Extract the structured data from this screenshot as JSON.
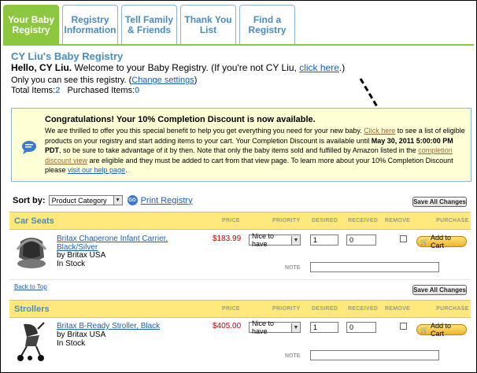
{
  "tabs": [
    {
      "label": "Your Baby\nRegistry",
      "active": true
    },
    {
      "label": "Registry\nInformation",
      "active": false
    },
    {
      "label": "Tell Family\n& Friends",
      "active": false
    },
    {
      "label": "Thank You\nList",
      "active": false
    },
    {
      "label": "Find a\nRegistry",
      "active": false
    }
  ],
  "header": {
    "title": "CY Liu's Baby Registry",
    "hello_bold": "Hello, CY Liu.",
    "hello_text": " Welcome to your Baby Registry. (If you're not CY Liu, ",
    "click_here": "click here",
    "hello_end": ".)",
    "only_text": "Only you can see this registry. (",
    "change_settings": "Change settings",
    "only_end": ")",
    "total_label": "Total Items:",
    "total_value": "2",
    "purchased_label": "Purchased Items:",
    "purchased_value": "0"
  },
  "banner": {
    "title": "Congratulations! Your 10% Completion Discount is now available.",
    "t1": "We are thrilled to offer you this special benefit to help you get everything you need for your new baby. ",
    "click_here": "Click here",
    "t2": " to see a list of eligible products on your registry and start adding items to your cart. Your Completion Discount is available until ",
    "date": "May 30, 2011 5:00:00 PM PDT",
    "t3": ", so be sure to take advantage of it by then. Note that only the baby items sold and fulfilled by Amazon listed in the ",
    "discount_view": "completion discount view",
    "t4": " are eligible and they must be added to cart from that view page. To learn more about your 10% Completion Discount please ",
    "help_page": "visit our help page",
    "t5": "."
  },
  "sort": {
    "label": "Sort by:",
    "selected": "Product Category",
    "go": "GO",
    "print": "Print Registry",
    "save_all": "Save All Changes"
  },
  "columns": {
    "price": "PRICE",
    "priority": "PRIORITY",
    "desired": "DESIRED",
    "received": "RECEIVED",
    "remove": "REMOVE",
    "purchase": "PURCHASE",
    "note": "NOTE"
  },
  "sections": [
    {
      "name": "Car Seats",
      "item": {
        "title_line1": "Britax Chaperone Infant Carrier,",
        "title_line2": "Black/Silver",
        "by": "by Britax USA",
        "stock": "In Stock",
        "price": "$183.99",
        "priority": "Nice to have",
        "desired": "1",
        "received": "0",
        "add_to_cart": "Add to Cart"
      }
    },
    {
      "name": "Strollers",
      "item": {
        "title_line1": "Britax B-Ready Stroller, Black",
        "title_line2": "",
        "by": "by Britax USA",
        "stock": "In Stock",
        "price": "$405.00",
        "priority": "Nice to have",
        "desired": "1",
        "received": "0",
        "add_to_cart": "Add to Cart"
      }
    }
  ],
  "back_to_top": "Back to Top",
  "colors": {
    "active_tab": "#8dc63f",
    "link_blue": "#1a5fb4",
    "section_yellow": "#ffe87c",
    "banner_bg": "#ffffd5",
    "price_red": "#cc0000"
  }
}
